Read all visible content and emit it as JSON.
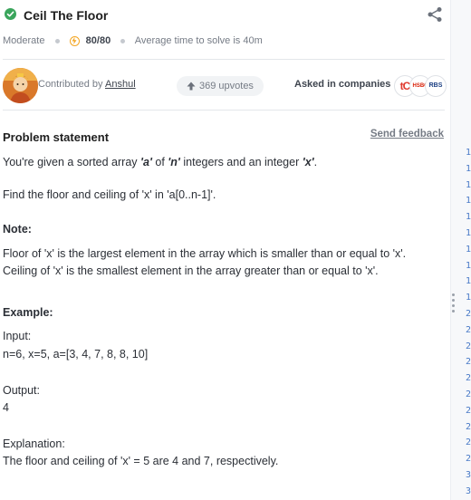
{
  "problem": {
    "title": "Ceil The Floor",
    "difficulty": "Moderate",
    "score": "80/80",
    "avg_time": "Average time to solve is 40m"
  },
  "contributor": {
    "prefix": "Contributed by",
    "name": "Anshul"
  },
  "upvotes": "369 upvotes",
  "asked": {
    "label": "Asked in companies",
    "logos": [
      "tC",
      "HSBC",
      "RBS"
    ]
  },
  "statement": {
    "heading": "Problem statement",
    "feedback": "Send feedback",
    "line1_parts": [
      "You're given a sorted array ",
      "'a'",
      " of ",
      "'n'",
      " integers and an integer ",
      "'x'",
      "."
    ],
    "line2": "Find the floor and ceiling of 'x' in 'a[0..n-1]'.",
    "note_heading": "Note:",
    "note1": "Floor of 'x' is the largest element in the array which is smaller than or equal to 'x'.",
    "note2": "Ceiling of 'x' is the smallest element in the array greater than or equal to 'x'.",
    "example_heading": "Example:",
    "input_label": "Input:",
    "input_value": "n=6, x=5, a=[3, 4, 7, 8, 8, 10]",
    "output_label": "Output:",
    "output_value": "4",
    "explanation_label": "Explanation:",
    "explanation_value": "The floor and ceiling of 'x' = 5 are 4 and 7, respectively."
  },
  "editor": {
    "line_numbers": [
      "1",
      "1",
      "1",
      "1",
      "1",
      "1",
      "1",
      "1",
      "1",
      "1",
      "2",
      "2",
      "2",
      "2",
      "2",
      "2",
      "2",
      "2",
      "2",
      "2",
      "3",
      "3"
    ]
  },
  "colors": {
    "success": "#3aa55c",
    "bolt": "#f4a623",
    "line_number": "#4a7ac7"
  }
}
